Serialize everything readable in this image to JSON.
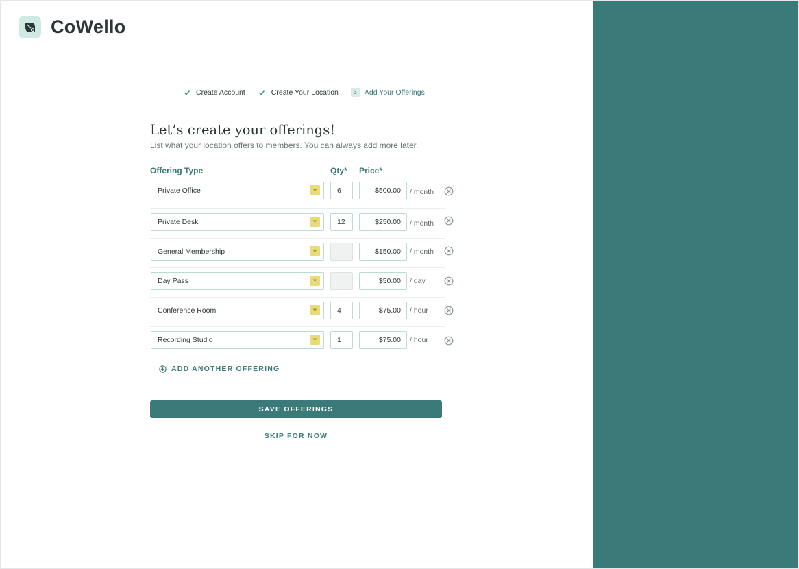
{
  "brand": {
    "name": "CoWello"
  },
  "steps": [
    {
      "label": "Create Account",
      "state": "done"
    },
    {
      "label": "Create Your Location",
      "state": "done"
    },
    {
      "label": "Add Your Offerings",
      "state": "active",
      "number": "3"
    }
  ],
  "page": {
    "title": "Let’s create your offerings!",
    "subtitle": "List what your location offers to members. You can always add more later."
  },
  "columns": {
    "type": "Offering Type",
    "qty": "Qty*",
    "price": "Price*"
  },
  "offerings": [
    {
      "type": "Private Office",
      "qty": "6",
      "price": "$500.00",
      "unit": "/ month"
    },
    {
      "type": "Private Desk",
      "qty": "12",
      "price": "$250.00",
      "unit": "/ month"
    },
    {
      "type": "General Membership",
      "qty": "",
      "price": "$150.00",
      "unit": "/ month"
    },
    {
      "type": "Day Pass",
      "qty": "",
      "price": "$50.00",
      "unit": "/ day"
    },
    {
      "type": "Conference Room",
      "qty": "4",
      "price": "$75.00",
      "unit": "/ hour"
    },
    {
      "type": "Recording Studio",
      "qty": "1",
      "price": "$75.00",
      "unit": "/ hour"
    }
  ],
  "actions": {
    "add_another": "ADD ANOTHER OFFERING",
    "save": "SAVE OFFERINGS",
    "skip": "SKIP FOR NOW"
  },
  "colors": {
    "accent": "#3a7a78",
    "caret": "#e8dc7a",
    "logo_bg": "#cfe9e4"
  }
}
